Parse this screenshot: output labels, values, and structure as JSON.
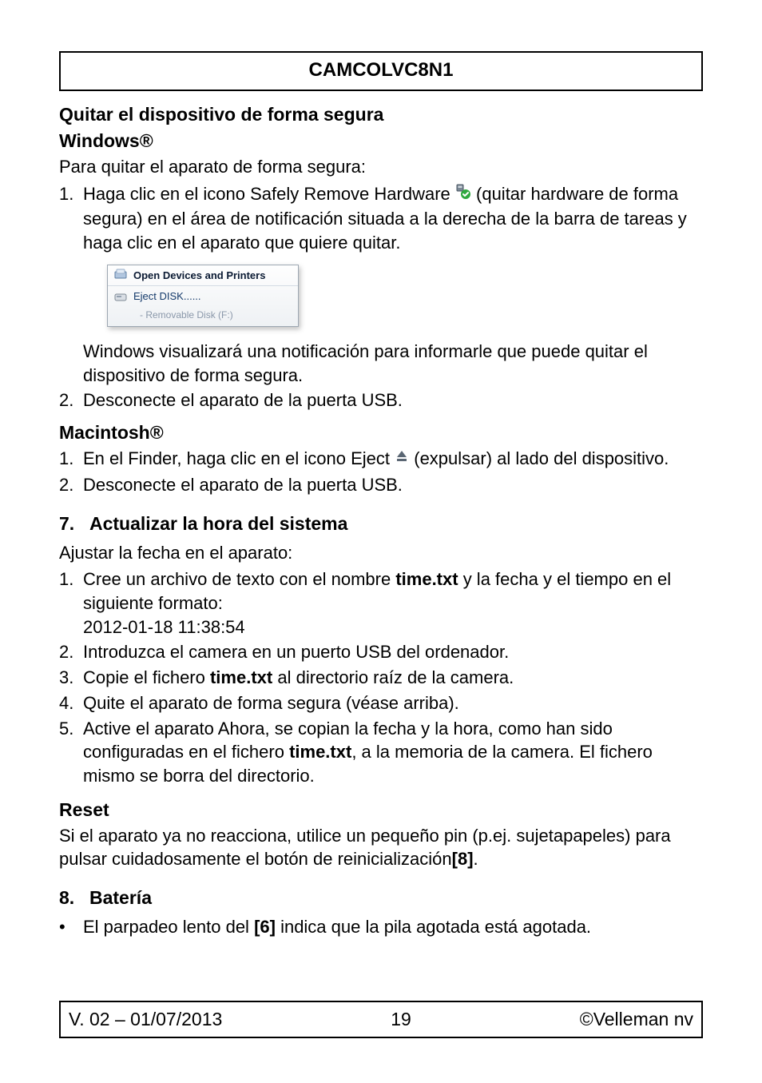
{
  "title": "CAMCOLVC8N1",
  "s_quitar": {
    "heading": "Quitar el dispositivo de forma segura",
    "win_h": "Windows®",
    "win_intro": "Para quitar el aparato de forma segura:",
    "win_step1_a": "Haga clic en el icono Safely Remove Hardware ",
    "win_step1_b": " (quitar hardware de forma segura) en el área de notificación situada a la derecha de la barra de tareas y haga clic en el aparato que quiere quitar.",
    "popup": {
      "open": "Open Devices and Printers",
      "eject": "Eject DISK......",
      "sub_prefix": "-   ",
      "sub": "Removable Disk (F:)"
    },
    "win_step1_after": "Windows visualizará una notificación para informarle que puede quitar el dispositivo de forma segura.",
    "win_step2": "Desconecte el aparato de la puerta USB.",
    "mac_h": "Macintosh®",
    "mac_step1_a": "En el Finder, haga clic en el icono Eject ",
    "mac_step1_b": " (expulsar) al lado del dispositivo.",
    "mac_step2": "Desconecte el aparato de la puerta USB."
  },
  "s7": {
    "no": "7.",
    "title": "Actualizar la hora del sistema",
    "intro": "Ajustar la fecha en el aparato:",
    "step1_a": "Cree un archivo de texto con el nombre ",
    "step1_file": "time.txt",
    "step1_b": " y la fecha y el tiempo en el siguiente formato:",
    "step1_example": "2012-01-18 11:38:54",
    "step2": "Introduzca el camera en un puerto USB del ordenador.",
    "step3_a": "Copie el fichero ",
    "step3_file": "time.txt",
    "step3_b": " al directorio raíz de la camera.",
    "step4": "Quite el aparato de forma segura (véase arriba).",
    "step5_a": "Active el aparato Ahora, se copian la fecha y la hora, como han sido configuradas en el fichero ",
    "step5_file": "time.txt",
    "step5_b": ", a la memoria de la camera. El fichero mismo se borra del directorio."
  },
  "reset": {
    "title": "Reset",
    "body_a": "Si el aparato ya no reacciona, utilice un pequeño pin (p.ej. sujetapapeles) para pulsar cuidadosamente el botón de reinicialización",
    "body_ref": "[8]",
    "body_b": "."
  },
  "s8": {
    "no": "8.",
    "title": "Batería",
    "bullet_a": "El parpadeo lento del ",
    "bullet_ref": "[6]",
    "bullet_b": " indica que la pila agotada está agotada."
  },
  "footer": {
    "left": "V. 02 – 01/07/2013",
    "center": "19",
    "right": "©Velleman nv"
  },
  "markers": {
    "m1": "1.",
    "m2": "2.",
    "m3": "3.",
    "m4": "4.",
    "m5": "5.",
    "bull": "•"
  }
}
